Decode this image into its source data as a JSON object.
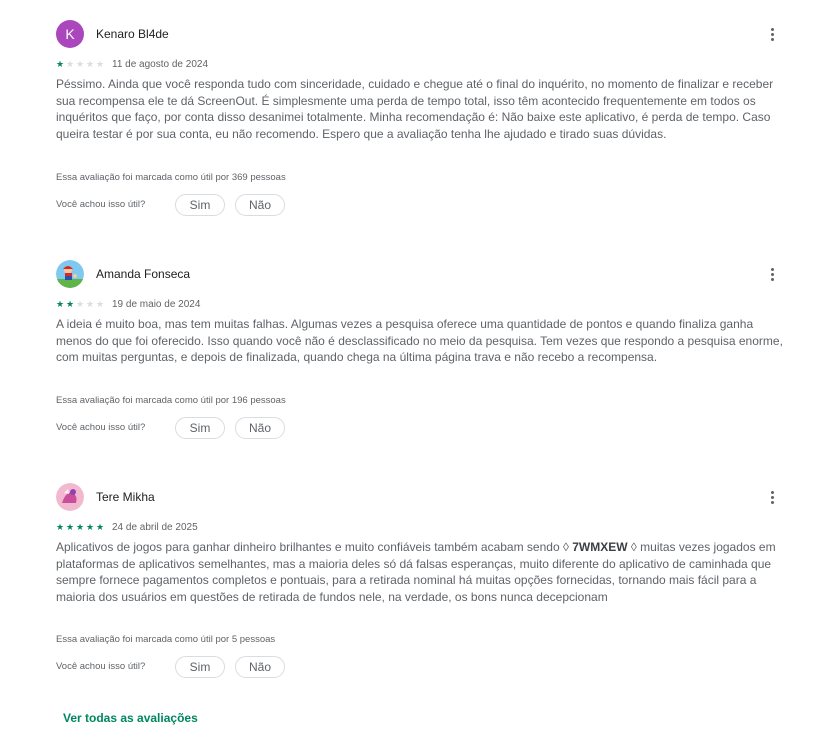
{
  "reviews": [
    {
      "author": "Kenaro Bl4de",
      "avatar_letter": "K",
      "rating": 1,
      "date": "11 de agosto de 2024",
      "text": "Péssimo. Ainda que você responda tudo com sinceridade, cuidado e chegue até o final do inquérito, no momento de finalizar e receber sua recompensa ele te dá ScreenOut. É simplesmente uma perda de tempo total, isso têm acontecido frequentemente em todos os inquéritos que faço, por conta disso desanimei totalmente. Minha recomendação é: Não baixe este aplicativo, é perda de tempo. Caso queira testar é por sua conta, eu não recomendo. Espero que a avaliação tenha lhe ajudado e tirado suas dúvidas.",
      "helpful": "Essa avaliação foi marcada como útil por 369 pessoas"
    },
    {
      "author": "Amanda Fonseca",
      "rating": 2,
      "date": "19 de maio de 2024",
      "text": "A ideia é muito boa, mas tem muitas falhas. Algumas vezes a pesquisa oferece uma quantidade de pontos e quando finaliza ganha menos do que foi oferecido. Isso quando você não é desclassificado no meio da pesquisa. Tem vezes que respondo a pesquisa enorme, com muitas perguntas, e depois de finalizada, quando chega na última página trava e não recebo a recompensa.",
      "helpful": "Essa avaliação foi marcada como útil por 196 pessoas"
    },
    {
      "author": "Tere Mikha",
      "rating": 5,
      "date": "24 de abril de 2025",
      "text_before": "Aplicativos de jogos para ganhar dinheiro brilhantes e muito confiáveis também acabam sendo ◊ ",
      "text_code": "7WMXEW",
      "text_after": " ◊ muitas vezes jogados em plataformas de aplicativos semelhantes, mas a maioria deles só dá falsas esperanças, muito diferente do aplicativo de caminhada que sempre fornece pagamentos completos e pontuais, para a retirada nominal há muitas opções fornecidas, tornando mais fácil para a maioria dos usuários em questões de retirada de fundos nele, na verdade, os bons nunca decepcionam",
      "helpful": "Essa avaliação foi marcada como útil por 5 pessoas"
    }
  ],
  "labels": {
    "ask": "Você achou isso útil?",
    "yes": "Sim",
    "no": "Não",
    "see_all": "Ver todas as avaliações"
  },
  "icons": {
    "more": "more-vert-icon",
    "star": "star-icon"
  },
  "colors": {
    "accent": "#01875f",
    "star_off": "#dadce0",
    "avatar_k": "#ab47bc"
  }
}
